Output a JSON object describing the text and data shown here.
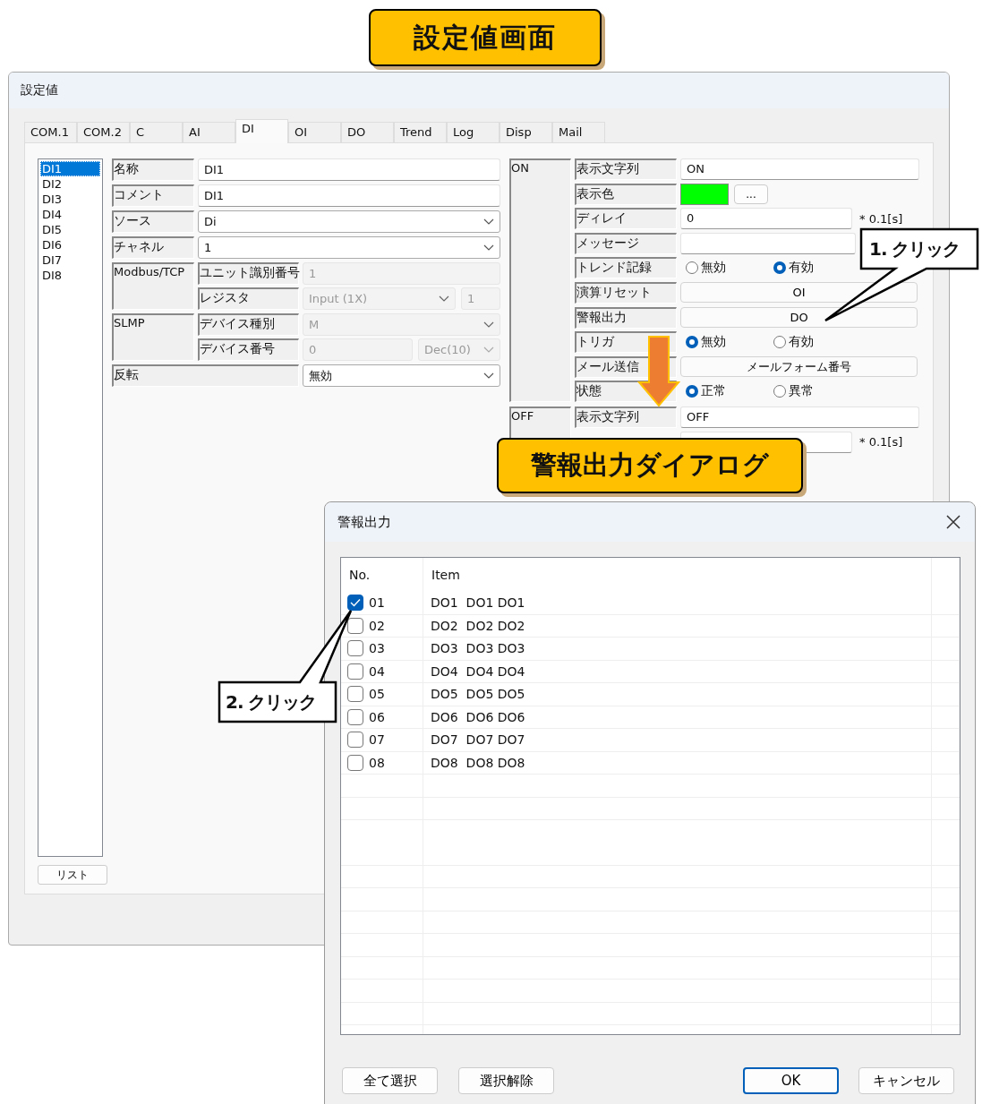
{
  "banner": {
    "title": "設定値画面"
  },
  "window": {
    "title": "設定値",
    "tabs": [
      {
        "label": "COM.1",
        "selected": false
      },
      {
        "label": "COM.2",
        "selected": false
      },
      {
        "label": "C",
        "selected": false
      },
      {
        "label": "AI",
        "selected": false
      },
      {
        "label": "DI",
        "selected": true
      },
      {
        "label": "OI",
        "selected": false
      },
      {
        "label": "DO",
        "selected": false
      },
      {
        "label": "Trend",
        "selected": false
      },
      {
        "label": "Log",
        "selected": false
      },
      {
        "label": "Disp",
        "selected": false
      },
      {
        "label": "Mail",
        "selected": false
      }
    ],
    "channel_list": [
      {
        "label": "DI1",
        "selected": true
      },
      {
        "label": "DI2",
        "selected": false
      },
      {
        "label": "DI3",
        "selected": false
      },
      {
        "label": "DI4",
        "selected": false
      },
      {
        "label": "DI5",
        "selected": false
      },
      {
        "label": "DI6",
        "selected": false
      },
      {
        "label": "DI7",
        "selected": false
      },
      {
        "label": "DI8",
        "selected": false
      }
    ],
    "list_button": "リスト",
    "form": [
      {
        "kind": "text",
        "label": "名称",
        "value": "DI1",
        "disabled": false
      },
      {
        "kind": "text",
        "label": "コメント",
        "value": "DI1",
        "disabled": false
      },
      {
        "kind": "select",
        "label": "ソース",
        "value": "Di",
        "disabled": false
      },
      {
        "kind": "select",
        "label": "チャネル",
        "value": "1",
        "disabled": false
      },
      {
        "kind": "group",
        "label": "Modbus/TCP",
        "rows": [
          {
            "kind": "text",
            "label": "ユニット識別番号",
            "value": "1",
            "disabled": true
          },
          {
            "kind": "select_text",
            "label": "レジスタ",
            "value": "Input (1X)",
            "value_2": "1",
            "disabled": true
          }
        ]
      },
      {
        "kind": "group",
        "label": "SLMP",
        "rows": [
          {
            "kind": "select",
            "label": "デバイス種別",
            "value": "M",
            "disabled": true
          },
          {
            "kind": "text_select",
            "label": "デバイス番号",
            "value": "0",
            "value_2": "Dec(10)",
            "disabled": true
          }
        ]
      },
      {
        "kind": "wide_select",
        "label": "反転",
        "value": "無効",
        "disabled": false
      }
    ],
    "states": [
      {
        "label": "ON",
        "rows": [
          {
            "kind": "text",
            "label": "表示文字列",
            "value": "ON"
          },
          {
            "kind": "color",
            "label": "表示色",
            "color": "#00ff00",
            "button": "..."
          },
          {
            "kind": "delay",
            "label": "ディレイ",
            "value": "0",
            "unit": "* 0.1[s]"
          },
          {
            "kind": "text",
            "label": "メッセージ"
          },
          {
            "kind": "radio",
            "label": "トレンド記録",
            "options": [
              {
                "label": "無効",
                "selected": false
              },
              {
                "label": "有効",
                "selected": true
              }
            ]
          },
          {
            "kind": "button",
            "label": "演算リセット",
            "value": "OI"
          },
          {
            "kind": "button",
            "label": "警報出力",
            "value": "DO"
          },
          {
            "kind": "radio",
            "label": "トリガ",
            "options": [
              {
                "label": "無効",
                "selected": true
              },
              {
                "label": "有効",
                "selected": false
              }
            ]
          },
          {
            "kind": "button",
            "label": "メール送信",
            "value": "メールフォーム番号"
          },
          {
            "kind": "radio",
            "label": "状態",
            "options": [
              {
                "label": "正常",
                "selected": true
              },
              {
                "label": "異常",
                "selected": false
              }
            ]
          }
        ]
      },
      {
        "label": "OFF",
        "rows": [
          {
            "kind": "text",
            "label": "表示文字列",
            "value": "OFF"
          },
          {
            "kind": "delay",
            "unit": "* 0.1[s]"
          }
        ]
      }
    ]
  },
  "dialog": {
    "title": "警報出力",
    "columns": [
      "No.",
      "Item"
    ],
    "rows": [
      {
        "no": "01",
        "item": "DO1  DO1 DO1",
        "checked": true
      },
      {
        "no": "02",
        "item": "DO2  DO2 DO2",
        "checked": false
      },
      {
        "no": "03",
        "item": "DO3  DO3 DO3",
        "checked": false
      },
      {
        "no": "04",
        "item": "DO4  DO4 DO4",
        "checked": false
      },
      {
        "no": "05",
        "item": "DO5  DO5 DO5",
        "checked": false
      },
      {
        "no": "06",
        "item": "DO6  DO6 DO6",
        "checked": false
      },
      {
        "no": "07",
        "item": "DO7  DO7 DO7",
        "checked": false
      },
      {
        "no": "08",
        "item": "DO8  DO8 DO8",
        "checked": false
      }
    ],
    "buttons": [
      {
        "label": "全て選択",
        "default": false
      },
      {
        "label": "選択解除",
        "default": false
      },
      {
        "label": "OK",
        "default": true
      },
      {
        "label": "キャンセル",
        "default": false
      }
    ]
  },
  "dialog_caption": "警報出力ダイアログ",
  "callouts": [
    {
      "text": "1. クリック"
    },
    {
      "text": "2. クリック"
    }
  ]
}
